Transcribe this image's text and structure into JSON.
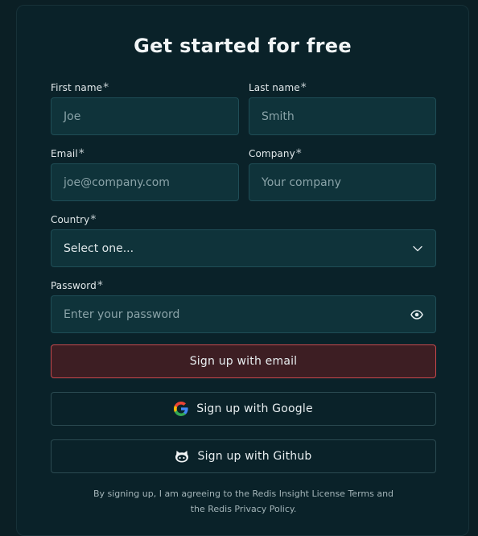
{
  "form": {
    "title": "Get started for free",
    "required_mark": "*",
    "first_name": {
      "label": "First name",
      "placeholder": "Joe"
    },
    "last_name": {
      "label": "Last name",
      "placeholder": "Smith"
    },
    "email": {
      "label": "Email",
      "placeholder": "joe@company.com"
    },
    "company": {
      "label": "Company",
      "placeholder": "Your company"
    },
    "country": {
      "label": "Country",
      "value": "Select one..."
    },
    "password": {
      "label": "Password",
      "placeholder": "Enter your password"
    },
    "buttons": {
      "email": "Sign up with email",
      "google": "Sign up with Google",
      "github": "Sign up with Github"
    },
    "legal_line1": "By signing up, I am agreeing to the Redis Insight License Terms and",
    "legal_line2": "the Redis Privacy Policy."
  },
  "icons": {
    "select": "chevron-down-icon",
    "password": "eye-icon",
    "google": "google-icon",
    "github": "github-icon"
  },
  "colors": {
    "background": "#0b1f25",
    "card": "#0a2229",
    "input": "#0f333a",
    "primary_button_bg": "#3d1e23",
    "primary_button_border": "#c8494d"
  }
}
